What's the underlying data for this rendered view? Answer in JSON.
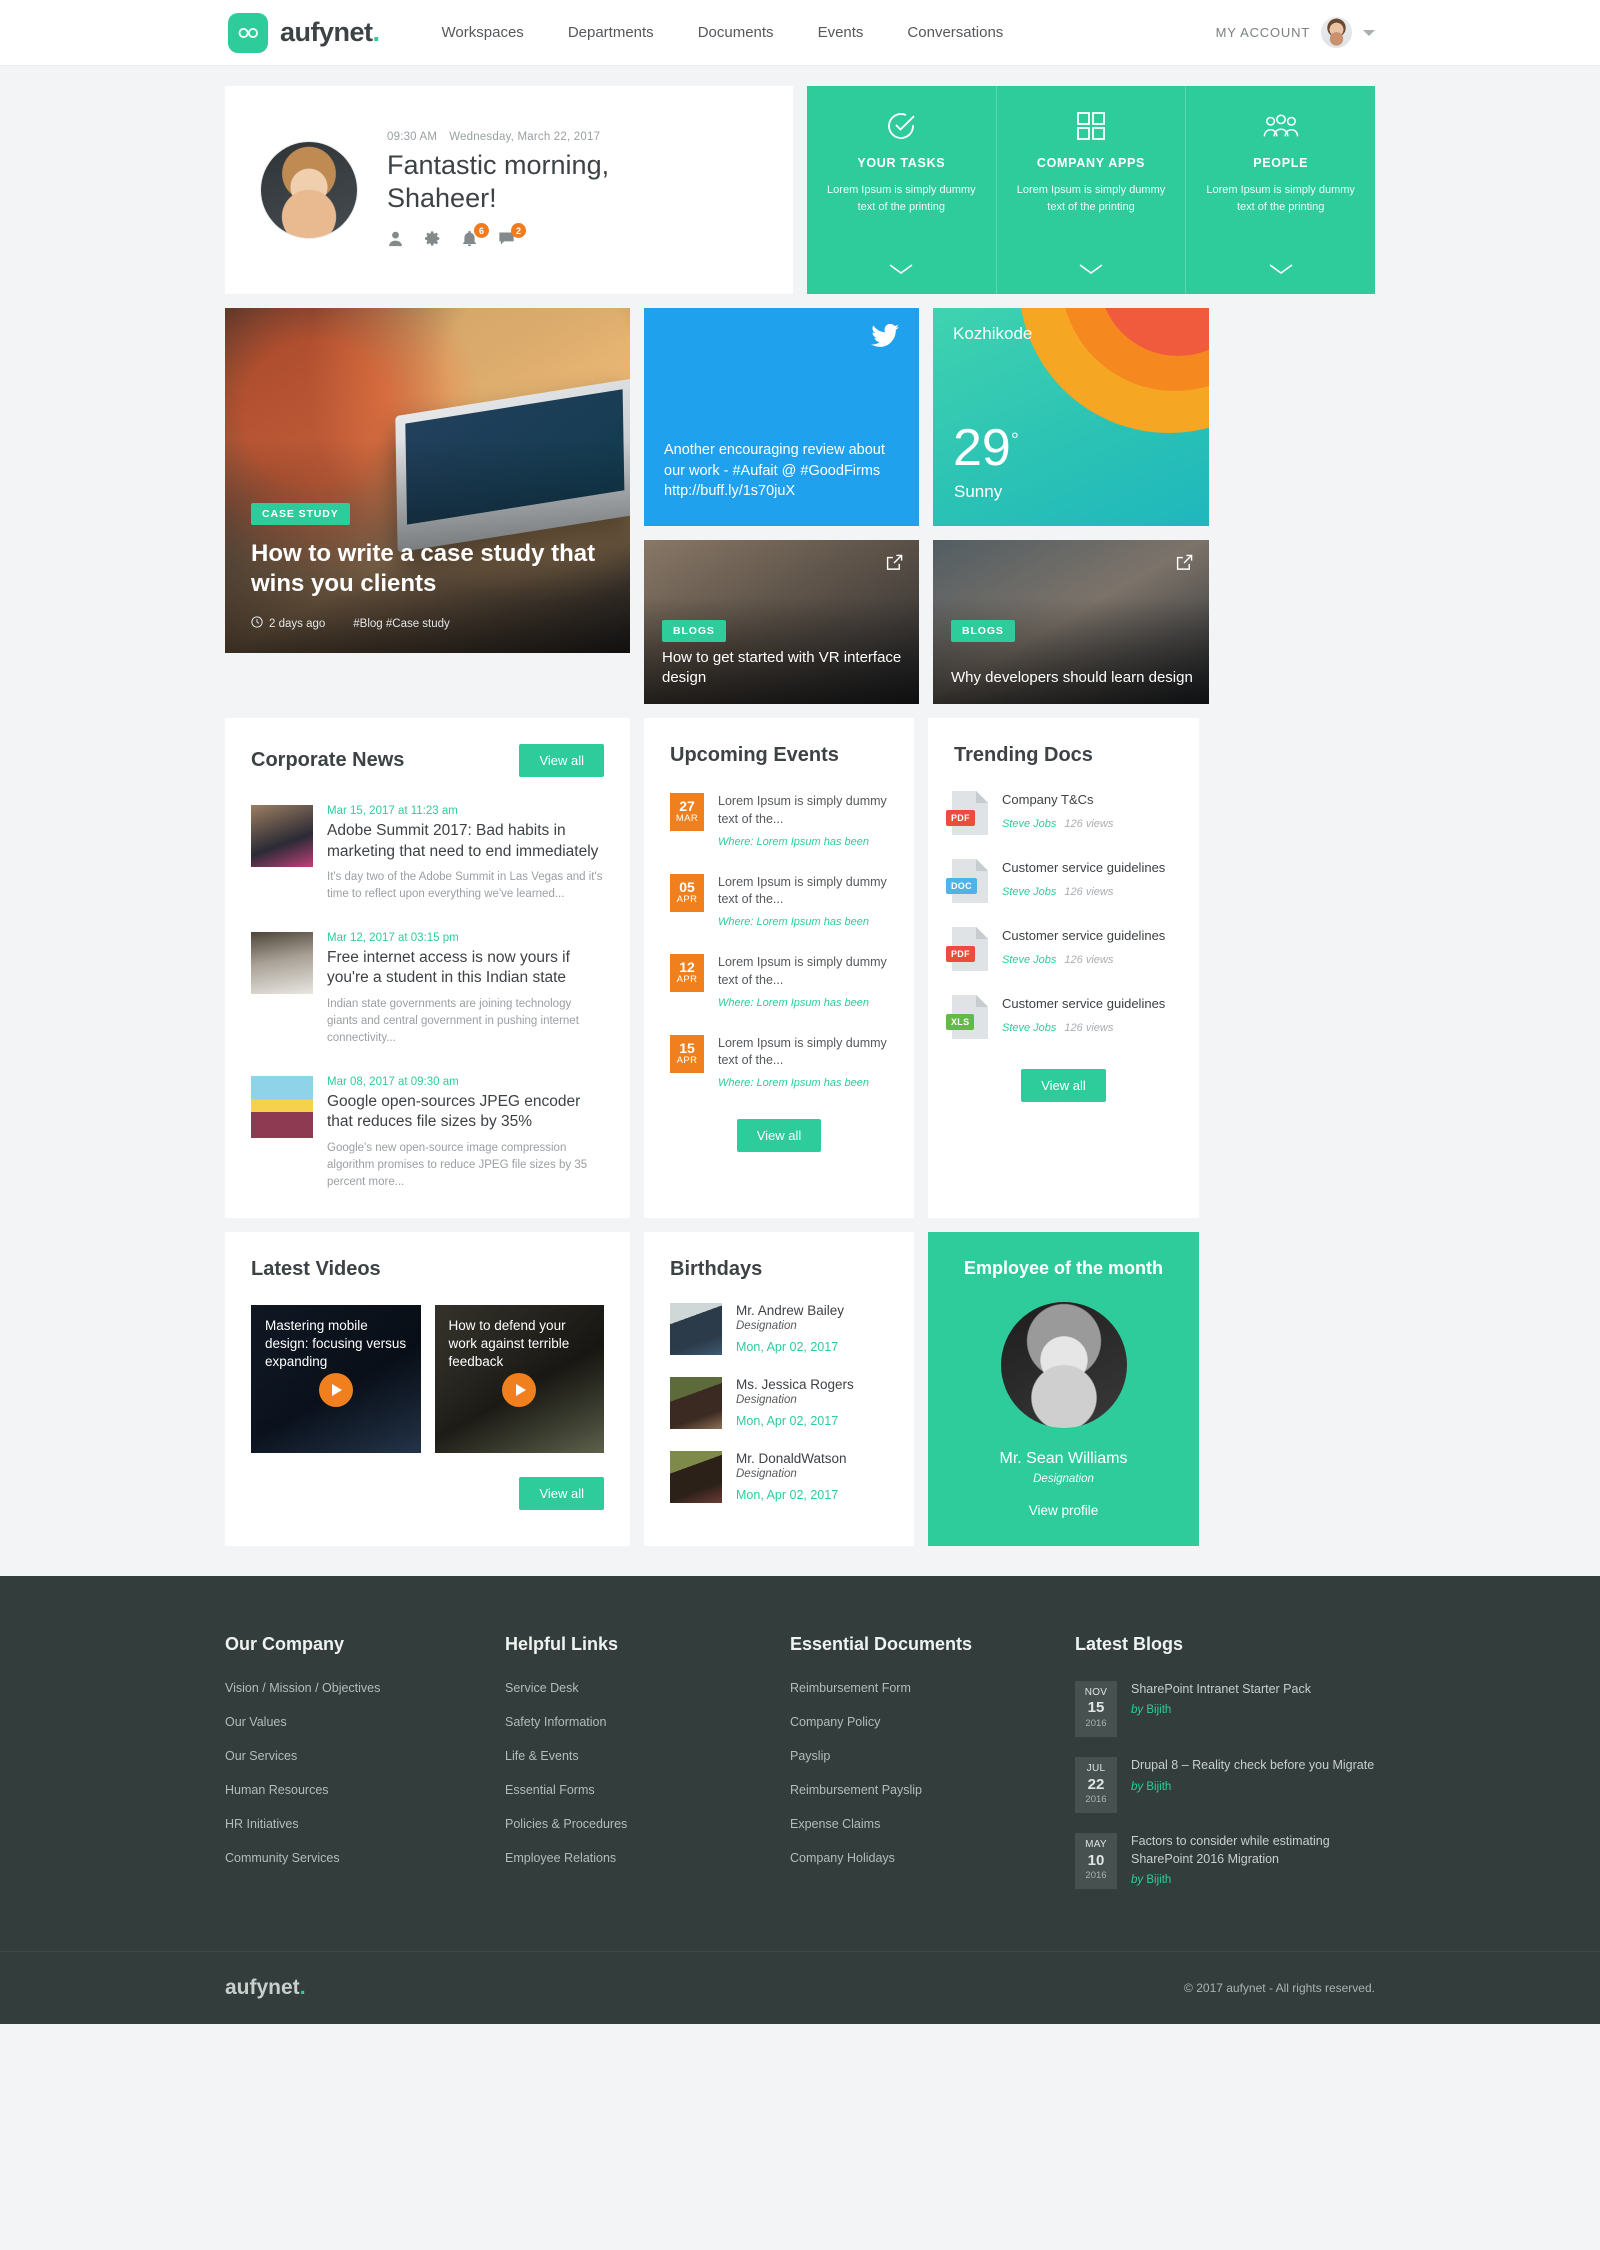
{
  "header": {
    "brand": {
      "name": "aufynet",
      "dot": ".",
      "mark_icon": "infinity-icon"
    },
    "nav": [
      {
        "label": "Workspaces"
      },
      {
        "label": "Departments"
      },
      {
        "label": "Documents"
      },
      {
        "label": "Events"
      },
      {
        "label": "Conversations"
      }
    ],
    "account": {
      "label": "MY ACCOUNT"
    }
  },
  "greeting": {
    "time": "09:30 AM",
    "date": "Wednesday, March 22, 2017",
    "title_line1": "Fantastic morning,",
    "title_line2": "Shaheer!",
    "icons": [
      {
        "name": "profile-icon",
        "badge": ""
      },
      {
        "name": "settings-gear-icon",
        "badge": ""
      },
      {
        "name": "notifications-bell-icon",
        "badge": "6"
      },
      {
        "name": "messages-chat-icon",
        "badge": "2"
      }
    ]
  },
  "tiles": [
    {
      "icon": "check-circle-icon",
      "title": "YOUR TASKS",
      "sub": "Lorem Ipsum is simply dummy text of the printing"
    },
    {
      "icon": "grid-apps-icon",
      "title": "COMPANY APPS",
      "sub": "Lorem Ipsum is simply dummy text of the printing"
    },
    {
      "icon": "people-group-icon",
      "title": "PEOPLE",
      "sub": "Lorem Ipsum is simply dummy text of the printing"
    }
  ],
  "hero": {
    "pill": "CASE STUDY",
    "title": "How to write a case study that wins you clients",
    "ago": "2 days ago",
    "tags": "#Blog #Case study"
  },
  "tweet": {
    "icon": "twitter-bird-icon",
    "text": "Another encouraging review about our work - #Aufait @ #GoodFirms http://buff.ly/1s70juX"
  },
  "weather": {
    "city": "Kozhikode",
    "temp": "29",
    "degree": "°",
    "condition": "Sunny"
  },
  "blog_cards": [
    {
      "pill": "BLOGS",
      "title": "How to get started with VR interface design",
      "icon": "external-link-icon"
    },
    {
      "pill": "BLOGS",
      "title": "Why developers should learn design",
      "icon": "external-link-icon"
    }
  ],
  "news": {
    "title": "Corporate News",
    "view_all": "View all",
    "items": [
      {
        "date": "Mar 15, 2017 at 11:23 am",
        "title": "Adobe Summit 2017: Bad habits in marketing that need to end immediately",
        "desc": "It's day two of the Adobe Summit in Las Vegas and it's time to reflect upon everything we've learned..."
      },
      {
        "date": "Mar 12, 2017 at 03:15 pm",
        "title": "Free internet access is now yours if you're a student in this Indian state",
        "desc": "Indian state governments are joining technology giants and central government in pushing internet connectivity..."
      },
      {
        "date": "Mar 08, 2017 at 09:30 am",
        "title": "Google open-sources JPEG encoder that reduces file sizes by 35%",
        "desc": "Google's new open-source image compression algorithm promises to reduce JPEG file sizes by 35 percent more..."
      }
    ]
  },
  "events": {
    "title": "Upcoming Events",
    "view_all": "View all",
    "items": [
      {
        "day": "27",
        "month": "MAR",
        "title": "Lorem Ipsum is simply dummy text of the...",
        "where": "Where: Lorem Ipsum has been"
      },
      {
        "day": "05",
        "month": "APR",
        "title": "Lorem Ipsum is simply dummy text of the...",
        "where": "Where: Lorem Ipsum has been"
      },
      {
        "day": "12",
        "month": "APR",
        "title": "Lorem Ipsum is simply dummy text of the...",
        "where": "Where: Lorem Ipsum has been"
      },
      {
        "day": "15",
        "month": "APR",
        "title": "Lorem Ipsum is simply dummy text of the...",
        "where": "Where: Lorem Ipsum has been"
      }
    ]
  },
  "docs": {
    "title": "Trending Docs",
    "view_all": "View all",
    "items": [
      {
        "type": "PDF",
        "title": "Company T&Cs",
        "author": "Steve Jobs",
        "views": "126 views"
      },
      {
        "type": "DOC",
        "title": "Customer service guidelines",
        "author": "Steve Jobs",
        "views": "126 views"
      },
      {
        "type": "PDF",
        "title": "Customer service guidelines",
        "author": "Steve Jobs",
        "views": "126 views"
      },
      {
        "type": "XLS",
        "title": "Customer service guidelines",
        "author": "Steve Jobs",
        "views": "126 views"
      }
    ]
  },
  "videos": {
    "title": "Latest Videos",
    "view_all": "View all",
    "items": [
      {
        "title": "Mastering mobile design: focusing versus expanding",
        "icon": "play-icon"
      },
      {
        "title": "How to defend your work against terrible feedback",
        "icon": "play-icon"
      }
    ]
  },
  "birthdays": {
    "title": "Birthdays",
    "items": [
      {
        "name": "Mr. Andrew Bailey",
        "designation": "Designation",
        "date": "Mon, Apr 02, 2017"
      },
      {
        "name": "Ms. Jessica Rogers",
        "designation": "Designation",
        "date": "Mon, Apr 02, 2017"
      },
      {
        "name": "Mr. DonaldWatson",
        "designation": "Designation",
        "date": "Mon, Apr 02, 2017"
      }
    ]
  },
  "employee_of_month": {
    "title": "Employee of the month",
    "name": "Mr. Sean Williams",
    "designation": "Designation",
    "link": "View profile"
  },
  "footer": {
    "columns": [
      {
        "heading": "Our Company",
        "links": [
          "Vision / Mission / Objectives",
          "Our Values",
          "Our Services",
          "Human Resources",
          "HR Initiatives",
          "Community Services"
        ]
      },
      {
        "heading": "Helpful Links",
        "links": [
          "Service Desk",
          "Safety Information",
          "Life & Events",
          "Essential Forms",
          "Policies & Procedures",
          "Employee Relations"
        ]
      },
      {
        "heading": "Essential Documents",
        "links": [
          "Reimbursement Form",
          "Company Policy",
          "Payslip",
          "Reimbursement Payslip",
          "Expense Claims",
          "Company Holidays"
        ]
      }
    ],
    "blogs": {
      "heading": "Latest Blogs",
      "items": [
        {
          "month": "NOV",
          "day": "15",
          "year": "2016",
          "title": "SharePoint Intranet Starter Pack",
          "by_prefix": "by",
          "author": "Bijith"
        },
        {
          "month": "JUL",
          "day": "22",
          "year": "2016",
          "title": "Drupal 8 – Reality check before you Migrate",
          "by_prefix": "by",
          "author": "Bijith"
        },
        {
          "month": "MAY",
          "day": "10",
          "year": "2016",
          "title": "Factors to consider while estimating SharePoint 2016 Migration",
          "by_prefix": "by",
          "author": "Bijith"
        }
      ]
    },
    "bottom": {
      "brand": "aufynet",
      "dot": ".",
      "copyright": "© 2017 aufynet - All rights reserved."
    }
  },
  "colors": {
    "accent_teal": "#2ecc9b",
    "orange": "#f0801e",
    "twitter_blue": "#1fa1ee",
    "footer_dark": "#333d3b",
    "pdf_red": "#ef4b3c",
    "doc_blue": "#4fb3e8",
    "xls_green": "#62bb46"
  }
}
